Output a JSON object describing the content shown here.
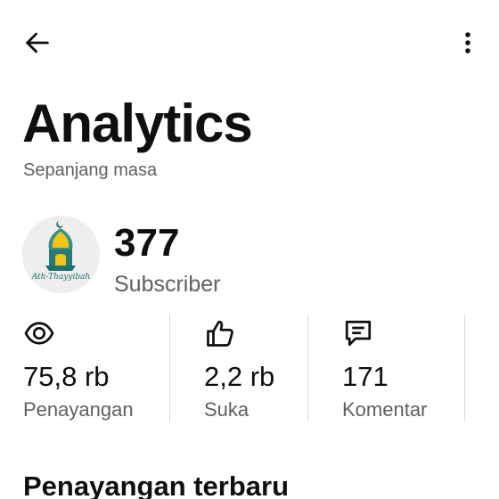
{
  "header": {
    "back_icon": "arrow-left-icon",
    "more_icon": "more-vertical-icon"
  },
  "page": {
    "title": "Analytics",
    "subtitle": "Sepanjang masa"
  },
  "channel": {
    "avatar_logo_text": "Ath-Thayyibah",
    "subscriber_count": "377",
    "subscriber_label": "Subscriber",
    "avatar_accent": "#1f6f6a"
  },
  "stats": [
    {
      "icon": "eye-icon",
      "value": "75,8 rb",
      "label": "Penayangan"
    },
    {
      "icon": "thumbs-up-icon",
      "value": "2,2 rb",
      "label": "Suka"
    },
    {
      "icon": "comment-icon",
      "value": "171",
      "label": "Komentar"
    }
  ],
  "section": {
    "title": "Penayangan terbaru"
  }
}
